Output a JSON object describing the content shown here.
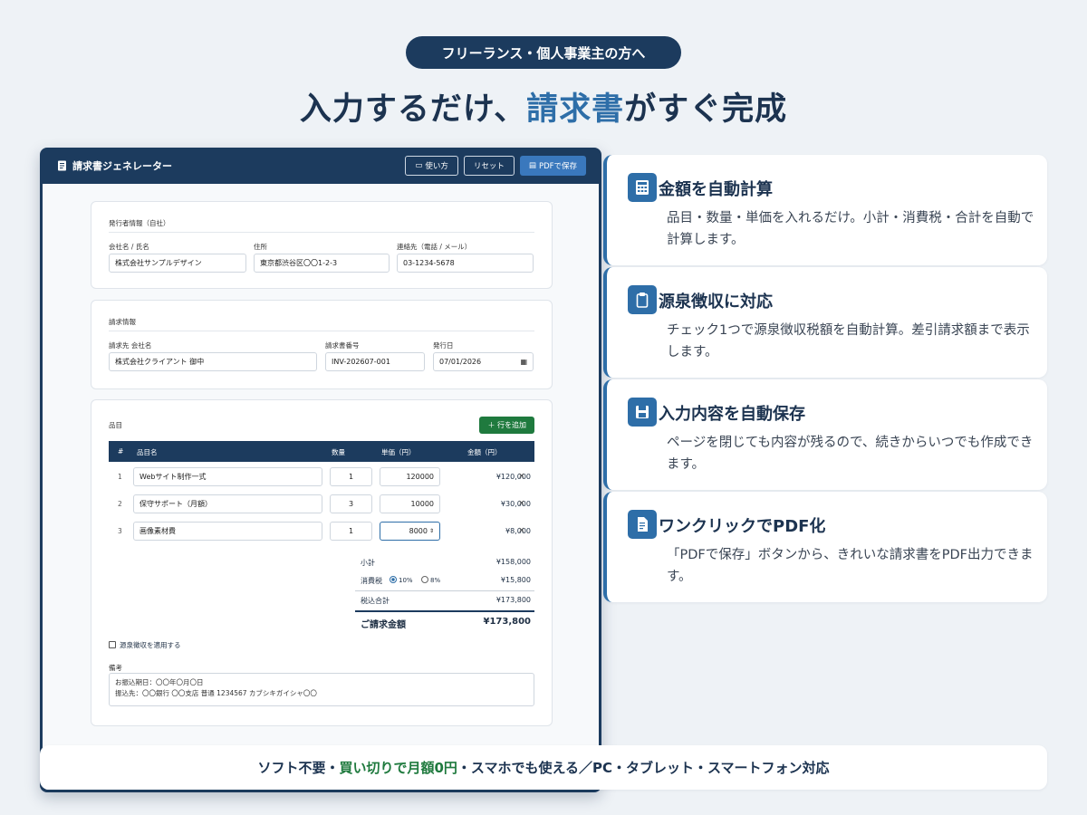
{
  "hero": {
    "pill": "フリーランス・個人事業主の方へ",
    "headline_pre": "入力するだけ、",
    "headline_highlight": "請求書",
    "headline_post": "がすぐ完成"
  },
  "app": {
    "title": "請求書ジェネレーター",
    "buttons": {
      "usage": "使い方",
      "reset": "リセット",
      "save_pdf": "PDFで保存"
    },
    "issuer": {
      "section_title": "発行者情報（自社）",
      "company_label": "会社名 / 氏名",
      "company_value": "株式会社サンプルデザイン",
      "address_label": "住所",
      "address_value": "東京都渋谷区〇〇1-2-3",
      "contact_label": "連絡先（電話 / メール）",
      "contact_value": "03-1234-5678"
    },
    "billing": {
      "section_title": "請求情報",
      "client_label": "請求先 会社名",
      "client_value": "株式会社クライアント 御中",
      "invoice_no_label": "請求書番号",
      "invoice_no_value": "INV-202607-001",
      "date_label": "発行日",
      "date_value": "07/01/2026"
    },
    "items": {
      "section_title": "品目",
      "add_row": "＋ 行を追加",
      "headers": {
        "no": "#",
        "name": "品目名",
        "qty": "数量",
        "price": "単価（円）",
        "amount": "金額（円）"
      },
      "rows": [
        {
          "no": "1",
          "name": "Webサイト制作一式",
          "qty": "1",
          "price": "120000",
          "amount": "¥120,000"
        },
        {
          "no": "2",
          "name": "保守サポート（月額）",
          "qty": "3",
          "price": "10000",
          "amount": "¥30,000"
        },
        {
          "no": "3",
          "name": "画像素材費",
          "qty": "1",
          "price": "8000",
          "amount": "¥8,000"
        }
      ],
      "delete_symbol": "×"
    },
    "summary": {
      "subtotal_label": "小計",
      "subtotal_value": "¥158,000",
      "tax_label": "消費税",
      "tax_opt1": "10%",
      "tax_opt2": "8%",
      "tax_value": "¥15,800",
      "total_label": "税込合計",
      "total_value": "¥173,800",
      "grand_label": "ご請求金額",
      "grand_value": "¥173,800"
    },
    "withholding_label": "源泉徴収を適用する",
    "notes_label": "備考",
    "notes_line1": "お振込期日：〇〇年〇月〇日",
    "notes_line2": "振込先：〇〇銀行 〇〇支店 普通 1234567 カブシキガイシャ〇〇"
  },
  "features": [
    {
      "icon": "calculator-icon",
      "title": "金額を自動計算",
      "desc": "品目・数量・単価を入れるだけ。小計・消費税・合計を自動で計算します。"
    },
    {
      "icon": "clipboard-icon",
      "title": "源泉徴収に対応",
      "desc": "チェック1つで源泉徴収税額を自動計算。差引請求額まで表示します。"
    },
    {
      "icon": "floppy-disk-icon",
      "title": "入力内容を自動保存",
      "desc": "ページを閉じても内容が残るので、続きからいつでも作成できます。"
    },
    {
      "icon": "document-icon",
      "title": "ワンクリックでPDF化",
      "desc": "「PDFで保存」ボタンから、きれいな請求書をPDF出力できます。"
    }
  ],
  "bottom": {
    "pre": "ソフト不要・",
    "highlight": "買い切りで月額0円",
    "post": "・スマホでも使える／PC・タブレット・スマートフォン対応"
  },
  "colors": {
    "navy": "#1c3b5e",
    "accent": "#2e6ea8",
    "green": "#1f7a3e",
    "background": "#eef2f6"
  }
}
